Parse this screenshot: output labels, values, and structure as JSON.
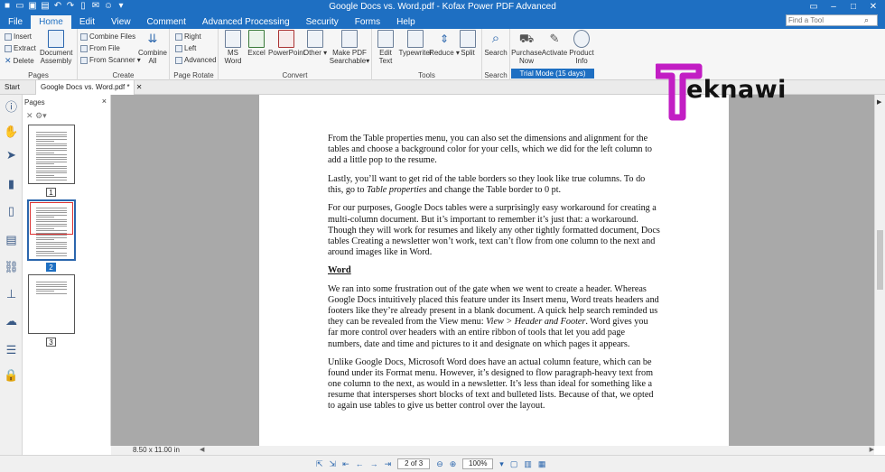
{
  "window": {
    "title": "Google Docs vs. Word.pdf - Kofax Power PDF Advanced"
  },
  "menu": {
    "tabs": [
      "File",
      "Home",
      "Edit",
      "View",
      "Comment",
      "Advanced Processing",
      "Security",
      "Forms",
      "Help"
    ],
    "active": "Home",
    "find_placeholder": "Find a Tool"
  },
  "ribbon": {
    "pages": {
      "label": "Pages",
      "insert": "Insert",
      "extract": "Extract",
      "delete": "Delete",
      "document_assembly": [
        "Document",
        "Assembly"
      ]
    },
    "create": {
      "label": "Create",
      "combine_files": "Combine Files",
      "from_file": "From File",
      "from_scanner": "From Scanner",
      "combine_all": [
        "Combine",
        "All"
      ]
    },
    "page_rotate": {
      "label": "Page Rotate",
      "right": "Right",
      "left": "Left",
      "advanced": "Advanced"
    },
    "convert": {
      "label": "Convert",
      "ms_word": [
        "MS",
        "Word"
      ],
      "excel": "Excel",
      "powerpoint": "PowerPoint",
      "other": "Other",
      "make_pdf_searchable": [
        "Make PDF",
        "Searchable"
      ]
    },
    "tools": {
      "label": "Tools",
      "edit_text": [
        "Edit",
        "Text"
      ],
      "typewriter": "Typewriter",
      "reduce": "Reduce",
      "split": "Split"
    },
    "search": {
      "label": "Search",
      "search": "Search"
    },
    "trial": {
      "purchase_now": [
        "Purchase",
        "Now"
      ],
      "activate": "Activate",
      "product_info": [
        "Product",
        "Info"
      ],
      "trial_mode": "Trial Mode (15 days)"
    }
  },
  "doc_tabs": {
    "start": "Start",
    "active": "Google Docs vs. Word.pdf *"
  },
  "pages_panel": {
    "header": "Pages",
    "close": "×",
    "thumbnails": [
      {
        "number": "1",
        "selected": false
      },
      {
        "number": "2",
        "selected": true
      },
      {
        "number": "3",
        "selected": false
      }
    ]
  },
  "document": {
    "paragraphs": [
      "From the Table properties menu, you can also set the dimensions and alignment for the tables and choose a background color for your cells, which we did for the left column to add a little pop to the resume.",
      "Lastly, you’ll want to get rid of the table borders so they look like true columns. To do this, go to",
      "Table properties",
      "and change the Table border to 0 pt.",
      "For our purposes, Google Docs tables were a surprisingly easy workaround for creating a multi-column document. But it’s important to remember it’s just that: a workaround. Though they will work for resumes and likely any other tightly formatted document, Docs tables Creating a newsletter won’t work, text can’t flow from one column to the next and around images like in Word.",
      "Word",
      "We ran into some frustration out of the gate when we went to create a header. Whereas Google Docs intuitively placed this feature under its Insert menu, Word treats headers and footers like they’re already present in a blank document. A quick help search reminded us they can be revealed from the View menu:",
      "View > Header and Footer",
      ". Word gives you far more control over headers with an entire ribbon of tools that let you add page numbers, date and time and pictures to it and designate on which pages it appears.",
      "Unlike Google Docs, Microsoft Word does have an actual column feature, which can be found under its Format menu. However, it’s designed to flow paragraph-heavy text from one column to the next, as would in a newsletter. It’s less than ideal for something like a resume that intersperses short blocks of text and bulleted lists. Because of that, we opted to again use tables to give us better control over the layout."
    ]
  },
  "status": {
    "page_size": "8.50 x 11.00 in",
    "page_indicator": "2 of 3",
    "zoom": "100%"
  },
  "watermark": {
    "text": "eknawi",
    "brand_color": "#c21ec4"
  }
}
